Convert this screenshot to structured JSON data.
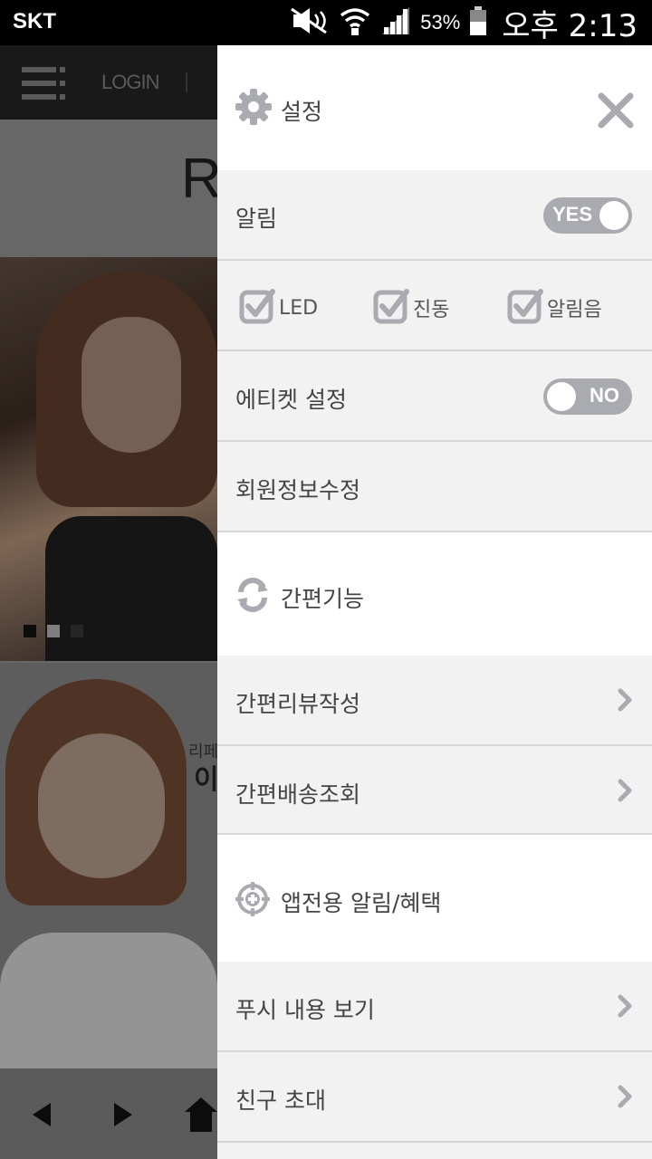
{
  "status_bar": {
    "carrier": "SKT",
    "battery": "53%",
    "time": "오후 2:13",
    "icons": [
      "mute-icon",
      "wifi-icon",
      "signal-icon",
      "battery-icon"
    ]
  },
  "background": {
    "login": "LOGIN",
    "banner_letter": "R",
    "side_text_small": "리페",
    "side_text_large": "이"
  },
  "drawer": {
    "header": {
      "icon": "gear-icon",
      "title": "설정",
      "close_icon": "close-icon"
    },
    "notification": {
      "label": "알림",
      "toggle": "YES",
      "enabled": true
    },
    "checkboxes": [
      {
        "label": "LED",
        "checked": true
      },
      {
        "label": "진동",
        "checked": true
      },
      {
        "label": "알림음",
        "checked": true
      }
    ],
    "etiquette": {
      "label": "에티켓 설정",
      "toggle": "NO",
      "enabled": false
    },
    "edit_member": {
      "label": "회원정보수정"
    },
    "quick_section": {
      "icon": "refresh-icon",
      "title": "간편기능"
    },
    "quick_items": [
      {
        "label": "간편리뷰작성"
      },
      {
        "label": "간편배송조회"
      }
    ],
    "app_section": {
      "icon": "target-icon",
      "title": "앱전용 알림/혜택"
    },
    "app_items": [
      {
        "label": "푸시 내용 보기"
      },
      {
        "label": "친구 초대"
      }
    ]
  },
  "colors": {
    "toggle_bg": "#a9abb0",
    "icon_gray": "#a9abb0",
    "drawer_bg": "#f2f2f2",
    "section_bg": "#ffffff"
  }
}
